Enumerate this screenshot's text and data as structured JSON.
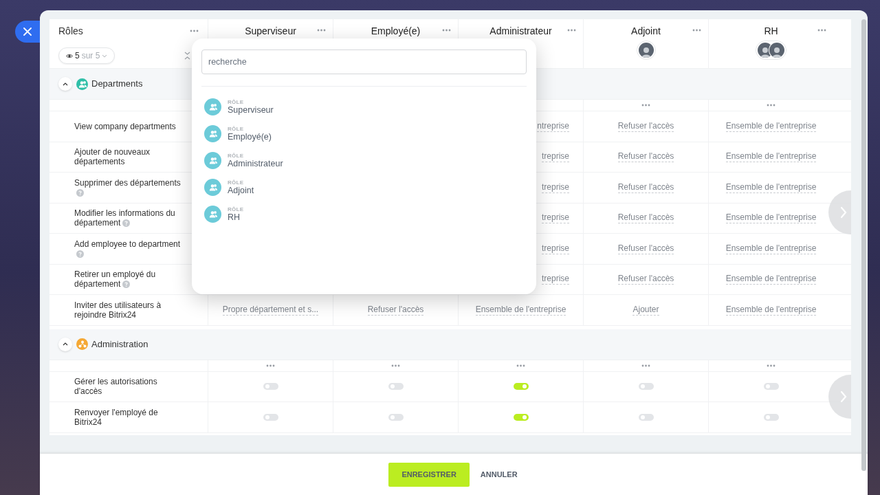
{
  "roles_header": {
    "title": "Rôles",
    "filter": {
      "count": "5",
      "total": "sur 5"
    }
  },
  "columns": [
    {
      "name": "Superviseur"
    },
    {
      "name": "Employé(e)"
    },
    {
      "name": "Administrateur"
    },
    {
      "name": "Adjoint"
    },
    {
      "name": "RH"
    }
  ],
  "popup": {
    "search_placeholder": "recherche",
    "items": [
      {
        "type_label": "RÔLE",
        "name": "Superviseur"
      },
      {
        "type_label": "RÔLE",
        "name": "Employé(e)"
      },
      {
        "type_label": "RÔLE",
        "name": "Administrateur"
      },
      {
        "type_label": "RÔLE",
        "name": "Adjoint"
      },
      {
        "type_label": "RÔLE",
        "name": "RH"
      }
    ]
  },
  "sections": [
    {
      "title": "Departments",
      "color": "#2fbfa8",
      "expanded": true,
      "menus": [
        false,
        false,
        false,
        true,
        true
      ],
      "rows": [
        {
          "label": "View company departments",
          "help": false,
          "cells": [
            null,
            null,
            {
              "kind": "select",
              "text": "ntreprise"
            },
            {
              "kind": "select",
              "text": "Refuser l'accès"
            },
            {
              "kind": "select",
              "text": "Ensemble de l'entreprise"
            }
          ]
        },
        {
          "label": "Ajouter de nouveaux départements",
          "help": false,
          "cells": [
            null,
            null,
            {
              "kind": "select",
              "text": "treprise"
            },
            {
              "kind": "select",
              "text": "Refuser l'accès"
            },
            {
              "kind": "select",
              "text": "Ensemble de l'entreprise"
            }
          ]
        },
        {
          "label": "Supprimer des départements",
          "help": true,
          "cells": [
            null,
            null,
            {
              "kind": "select",
              "text": "treprise"
            },
            {
              "kind": "select",
              "text": "Refuser l'accès"
            },
            {
              "kind": "select",
              "text": "Ensemble de l'entreprise"
            }
          ]
        },
        {
          "label": "Modifier les informations du département",
          "help": true,
          "cells": [
            null,
            null,
            {
              "kind": "select",
              "text": "treprise"
            },
            {
              "kind": "select",
              "text": "Refuser l'accès"
            },
            {
              "kind": "select",
              "text": "Ensemble de l'entreprise"
            }
          ]
        },
        {
          "label": "Add employee to department",
          "help": true,
          "cells": [
            null,
            null,
            {
              "kind": "select",
              "text": "treprise"
            },
            {
              "kind": "select",
              "text": "Refuser l'accès"
            },
            {
              "kind": "select",
              "text": "Ensemble de l'entreprise"
            }
          ]
        },
        {
          "label": "Retirer un employé du département",
          "help": true,
          "cells": [
            null,
            null,
            {
              "kind": "select",
              "text": "treprise"
            },
            {
              "kind": "select",
              "text": "Refuser l'accès"
            },
            {
              "kind": "select",
              "text": "Ensemble de l'entreprise"
            }
          ]
        },
        {
          "label": "Inviter des utilisateurs à rejoindre Bitrix24",
          "help": false,
          "cells": [
            {
              "kind": "select",
              "text": "Propre département et s..."
            },
            {
              "kind": "select",
              "text": "Refuser l'accès"
            },
            {
              "kind": "select",
              "text": "Ensemble de l'entreprise"
            },
            {
              "kind": "select",
              "text": "Ajouter"
            },
            {
              "kind": "select",
              "text": "Ensemble de l'entreprise"
            }
          ]
        }
      ]
    },
    {
      "title": "Administration",
      "color": "#f5a834",
      "expanded": true,
      "menus": [
        true,
        true,
        true,
        true,
        true
      ],
      "rows": [
        {
          "label": "Gérer les autorisations d'accès",
          "help": false,
          "cells": [
            {
              "kind": "toggle",
              "on": false
            },
            {
              "kind": "toggle",
              "on": false
            },
            {
              "kind": "toggle",
              "on": true
            },
            {
              "kind": "toggle",
              "on": false
            },
            {
              "kind": "toggle",
              "on": false
            }
          ]
        },
        {
          "label": "Renvoyer l'employé de Bitrix24",
          "help": false,
          "cells": [
            {
              "kind": "toggle",
              "on": false
            },
            {
              "kind": "toggle",
              "on": false
            },
            {
              "kind": "toggle",
              "on": true
            },
            {
              "kind": "toggle",
              "on": false
            },
            {
              "kind": "toggle",
              "on": false
            }
          ]
        }
      ]
    }
  ],
  "footer": {
    "buttons": [
      {
        "label": "ENREGISTRER",
        "kind": "primary"
      },
      {
        "label": "ANNULER",
        "kind": "link"
      }
    ]
  }
}
